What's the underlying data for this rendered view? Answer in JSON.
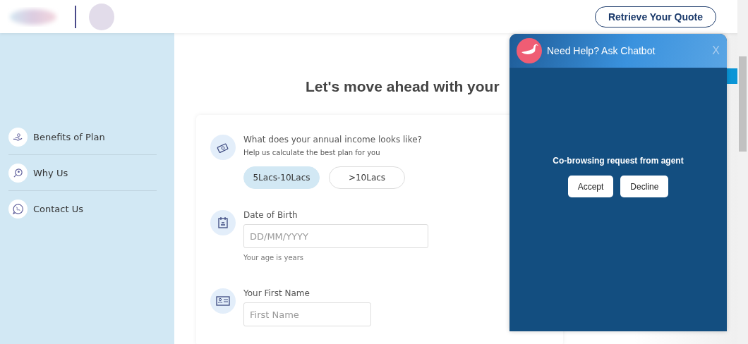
{
  "header": {
    "retrieve_button": "Retrieve Your Quote"
  },
  "sidebar": {
    "items": [
      {
        "label": "Benefits of Plan",
        "kind": "benefits"
      },
      {
        "label": "Why Us",
        "kind": "why"
      },
      {
        "label": "Contact Us",
        "kind": "contact"
      }
    ]
  },
  "main": {
    "heading": "Let's move ahead with your",
    "income": {
      "question": "What does your annual income looks like?",
      "hint": "Help us calculate the best plan for you",
      "options": [
        {
          "label": "5Lacs-10Lacs",
          "selected": true
        },
        {
          "label": ">10Lacs",
          "selected": false
        }
      ]
    },
    "dob": {
      "label": "Date of Birth",
      "placeholder": "DD/MM/YYYY",
      "note": "Your age is  years"
    },
    "first_name": {
      "label": "Your First Name",
      "placeholder": "First Name"
    }
  },
  "chatbot": {
    "title": "Need Help? Ask Chatbot",
    "close": "X",
    "message": "Co-browsing request from agent",
    "buttons": [
      "Accept",
      "Decline"
    ]
  }
}
